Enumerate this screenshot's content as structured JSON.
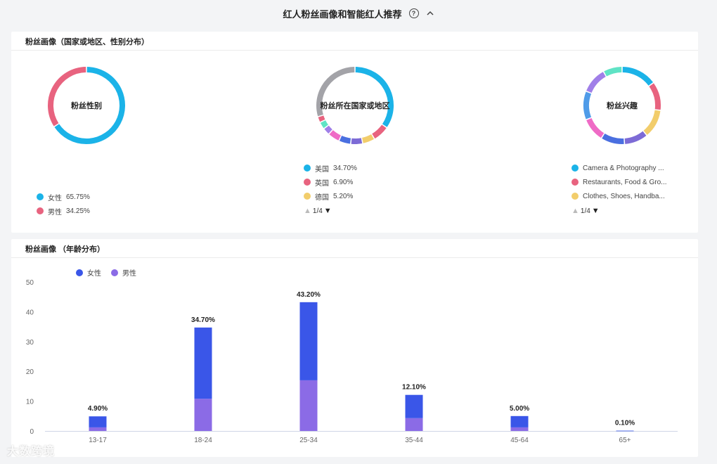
{
  "header": {
    "title": "红人粉丝画像和智能红人推荐",
    "help_icon": "?",
    "collapse_icon": "chevron-up-icon"
  },
  "panel_region": {
    "title": "粉丝画像（国家或地区、性别分布）",
    "gender": {
      "label": "粉丝性别",
      "items": [
        {
          "name": "女性",
          "value": "65.75%",
          "pct": 65.75,
          "color": "#1bb3e8"
        },
        {
          "name": "男性",
          "value": "34.25%",
          "pct": 34.25,
          "color": "#e8637f"
        }
      ]
    },
    "country": {
      "label": "粉丝所在国家或地区",
      "items": [
        {
          "name": "美国",
          "value": "34.70%",
          "color": "#1bb3e8"
        },
        {
          "name": "英国",
          "value": "6.90%",
          "color": "#e8637f"
        },
        {
          "name": "德国",
          "value": "5.20%",
          "color": "#f2cd6b"
        }
      ],
      "pager": "1/4"
    },
    "interest": {
      "label": "粉丝兴趣",
      "items": [
        {
          "text": "Camera & Photography ...",
          "color": "#1bb3e8"
        },
        {
          "text": "Restaurants, Food & Gro...",
          "color": "#e8637f"
        },
        {
          "text": "Clothes, Shoes, Handba...",
          "color": "#f2cd6b"
        }
      ],
      "pager": "1/4"
    }
  },
  "panel_age": {
    "title": "粉丝画像  （年龄分布）",
    "legend": [
      {
        "name": "女性",
        "color": "#3a56e8"
      },
      {
        "name": "男性",
        "color": "#8b6be6"
      }
    ]
  },
  "chart_data": {
    "type": "bar",
    "stacked": true,
    "categories": [
      "13-17",
      "18-24",
      "25-34",
      "35-44",
      "45-64",
      "65+"
    ],
    "totals": [
      4.9,
      34.7,
      43.2,
      12.1,
      5.0,
      0.1
    ],
    "total_labels": [
      "4.90%",
      "34.70%",
      "43.20%",
      "12.10%",
      "5.00%",
      "0.10%"
    ],
    "series": [
      {
        "name": "男性",
        "values": [
          1.2,
          10.8,
          17.0,
          4.3,
          1.2,
          0.0
        ],
        "color": "#8b6be6"
      },
      {
        "name": "女性",
        "values": [
          3.7,
          23.9,
          26.2,
          7.8,
          3.8,
          0.1
        ],
        "color": "#3a56e8"
      }
    ],
    "ylim": [
      0,
      50
    ],
    "yticks": [
      0,
      10,
      20,
      30,
      40,
      50
    ],
    "grid": false
  },
  "watermark": "大数跨境"
}
